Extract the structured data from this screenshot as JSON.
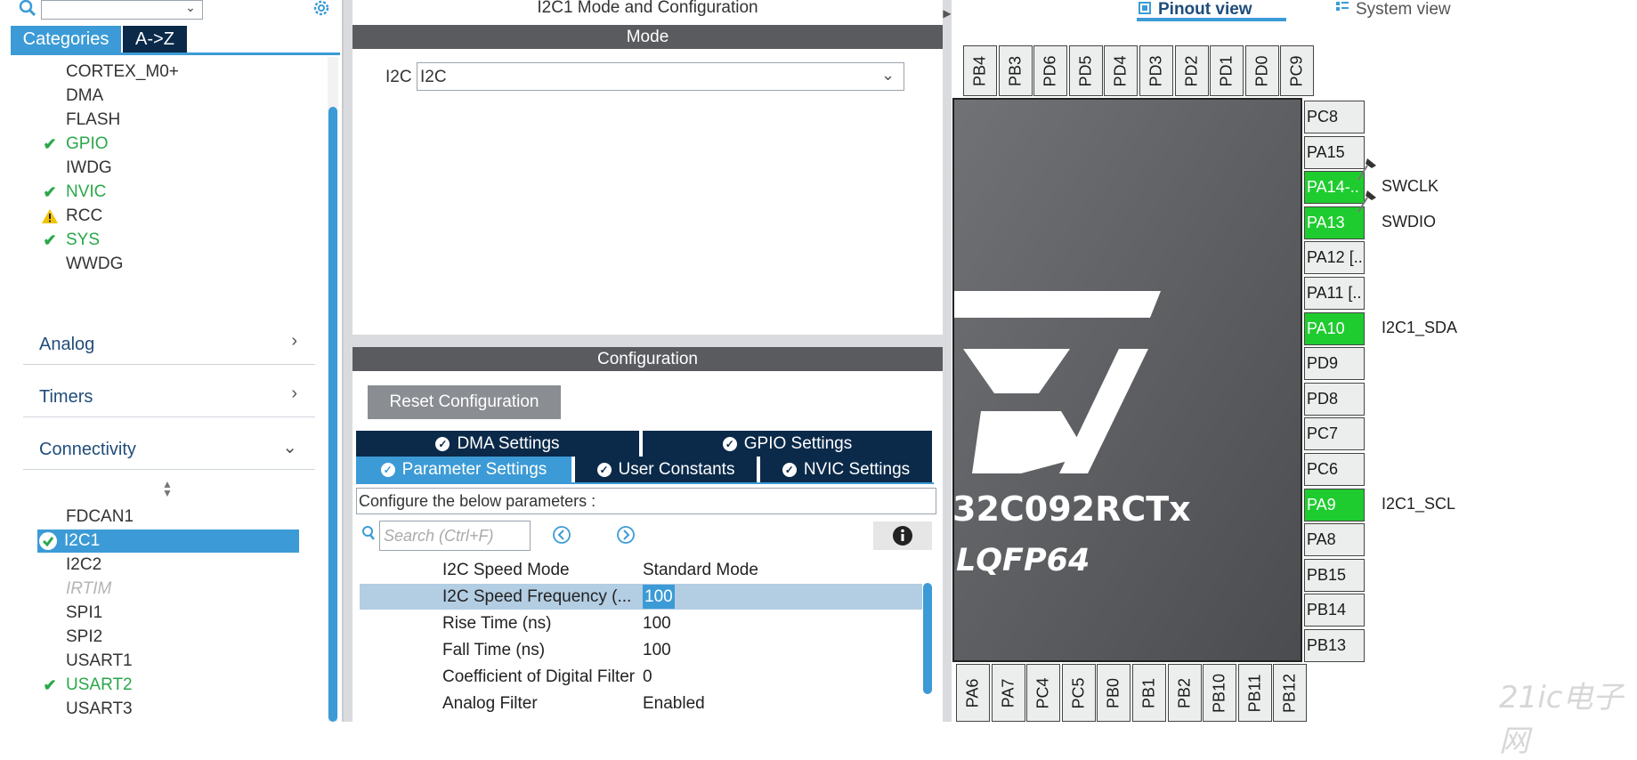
{
  "left_panel": {
    "tab_categories": "Categories",
    "tab_az": "A->Z",
    "system_core_items": [
      {
        "label": "CORTEX_M0+",
        "status": "none"
      },
      {
        "label": "DMA",
        "status": "none"
      },
      {
        "label": "FLASH",
        "status": "none"
      },
      {
        "label": "GPIO",
        "status": "ok"
      },
      {
        "label": "IWDG",
        "status": "none"
      },
      {
        "label": "NVIC",
        "status": "ok"
      },
      {
        "label": "RCC",
        "status": "warning"
      },
      {
        "label": "SYS",
        "status": "ok"
      },
      {
        "label": "WWDG",
        "status": "none"
      }
    ],
    "groups": {
      "analog": "Analog",
      "timers": "Timers",
      "connectivity": "Connectivity"
    },
    "connectivity_items": [
      {
        "label": "FDCAN1",
        "status": "none"
      },
      {
        "label": "I2C1",
        "status": "selected"
      },
      {
        "label": "I2C2",
        "status": "none"
      },
      {
        "label": "IRTIM",
        "status": "disabled"
      },
      {
        "label": "SPI1",
        "status": "none"
      },
      {
        "label": "SPI2",
        "status": "none"
      },
      {
        "label": "USART1",
        "status": "none"
      },
      {
        "label": "USART2",
        "status": "ok"
      },
      {
        "label": "USART3",
        "status": "none"
      }
    ]
  },
  "middle": {
    "title": "I2C1 Mode and Configuration",
    "mode_header": "Mode",
    "i2c_label": "I2C",
    "i2c_value": "I2C",
    "config_header": "Configuration",
    "reset_button": "Reset Configuration",
    "tabs": {
      "dma": "DMA Settings",
      "gpio": "GPIO Settings",
      "param": "Parameter Settings",
      "user": "User Constants",
      "nvic": "NVIC Settings"
    },
    "configure_label": "Configure the below parameters :",
    "search_placeholder": "Search (Ctrl+F)",
    "params": [
      {
        "name": "I2C Speed Mode",
        "value": "Standard Mode"
      },
      {
        "name": "I2C Speed Frequency (...",
        "value": "100"
      },
      {
        "name": "Rise Time (ns)",
        "value": "100"
      },
      {
        "name": "Fall Time (ns)",
        "value": "100"
      },
      {
        "name": "Coefficient of Digital Filter",
        "value": "0"
      },
      {
        "name": "Analog Filter",
        "value": "Enabled"
      }
    ]
  },
  "right": {
    "pinout_tab": "Pinout view",
    "system_tab": "System view",
    "chip_name": "32C092RCTx",
    "package": "LQFP64",
    "top_pins": [
      "PB4",
      "PB3",
      "PD6",
      "PD5",
      "PD4",
      "PD3",
      "PD2",
      "PD1",
      "PD0",
      "PC9"
    ],
    "bottom_pins": [
      "PA6",
      "PA7",
      "PC4",
      "PC5",
      "PB0",
      "PB1",
      "PB2",
      "PB10",
      "PB11",
      "PB12"
    ],
    "right_pins": [
      {
        "label": "PC8",
        "active": false,
        "signal": ""
      },
      {
        "label": "PA15",
        "active": false,
        "signal": ""
      },
      {
        "label": "PA14-..",
        "active": true,
        "signal": "SWCLK"
      },
      {
        "label": "PA13",
        "active": true,
        "signal": "SWDIO"
      },
      {
        "label": "PA12 [..",
        "active": false,
        "signal": ""
      },
      {
        "label": "PA11 [..",
        "active": false,
        "signal": ""
      },
      {
        "label": "PA10",
        "active": true,
        "signal": "I2C1_SDA"
      },
      {
        "label": "PD9",
        "active": false,
        "signal": ""
      },
      {
        "label": "PD8",
        "active": false,
        "signal": ""
      },
      {
        "label": "PC7",
        "active": false,
        "signal": ""
      },
      {
        "label": "PC6",
        "active": false,
        "signal": ""
      },
      {
        "label": "PA9",
        "active": true,
        "signal": "I2C1_SCL"
      },
      {
        "label": "PA8",
        "active": false,
        "signal": ""
      },
      {
        "label": "PB15",
        "active": false,
        "signal": ""
      },
      {
        "label": "PB14",
        "active": false,
        "signal": ""
      },
      {
        "label": "PB13",
        "active": false,
        "signal": ""
      }
    ],
    "watermark": "21ic电子网"
  },
  "colors": {
    "accent": "#3c9bd6",
    "navy": "#0b2a4a",
    "pin_active": "#1fcc2f",
    "ok": "#2aa84a",
    "warning": "#f2c200"
  }
}
